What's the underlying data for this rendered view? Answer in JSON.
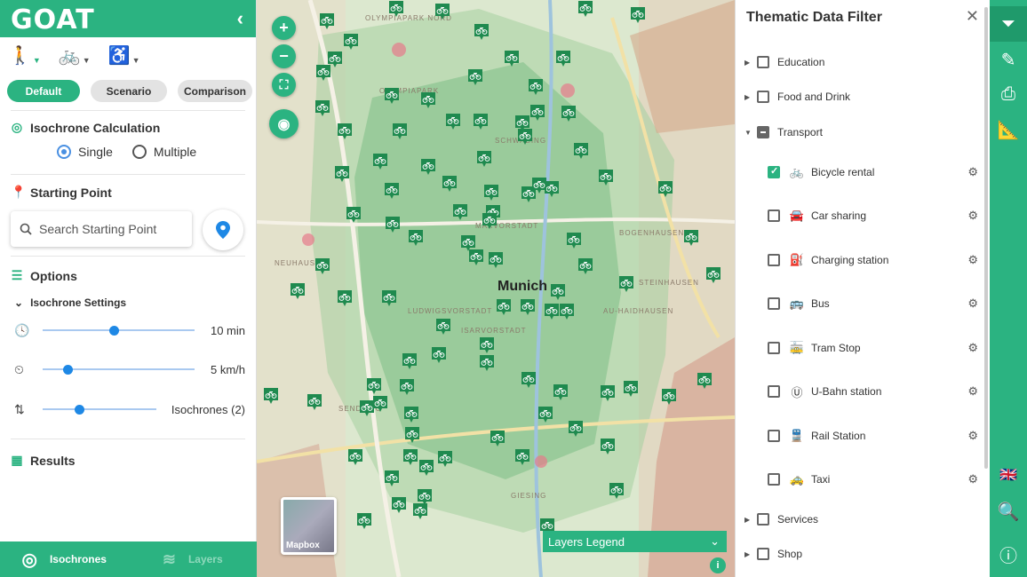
{
  "app": {
    "logo": "GOAT"
  },
  "modes": [
    {
      "name": "walking",
      "glyph": "🚶"
    },
    {
      "name": "cycling",
      "glyph": "🚲"
    },
    {
      "name": "wheelchair",
      "glyph": "♿"
    }
  ],
  "tabs": [
    "Default",
    "Scenario",
    "Comparison"
  ],
  "isochrone": {
    "title": "Isochrone Calculation",
    "single": "Single",
    "multiple": "Multiple"
  },
  "starting_point": {
    "title": "Starting Point",
    "placeholder": "Search Starting Point"
  },
  "options": {
    "title": "Options",
    "settings_title": "Isochrone Settings",
    "sliders": [
      {
        "icon": "clock-icon",
        "value": "10 min",
        "level": 0.55
      },
      {
        "icon": "speedometer-icon",
        "value": "5 km/h",
        "level": 0.17
      },
      {
        "icon": "sort-icon",
        "value": "Isochrones (2)",
        "level": 0.3
      }
    ]
  },
  "results": {
    "title": "Results"
  },
  "footer": {
    "isochrones": "Isochrones",
    "layers": "Layers"
  },
  "map": {
    "city": "Munich",
    "mapbox_label": "Mapbox",
    "legend_label": "Layers Legend",
    "labels": [
      "OLYMPIAPARK NORD",
      "OLYMPIAPARK",
      "SCHWABING",
      "MAXVORSTADT",
      "AU-HAIDHAUSEN",
      "SENDLING",
      "BOGENHAUSEN",
      "GIESING",
      "LUDWIGSVORSTADT",
      "ISARVORSTADT",
      "STEINHAUSEN",
      "NEUHAUSEN"
    ],
    "info": "i"
  },
  "filter": {
    "title": "Thematic Data Filter",
    "categories": {
      "education": "Education",
      "food": "Food and Drink",
      "transport": "Transport",
      "services": "Services",
      "shop": "Shop"
    },
    "transport_items": [
      {
        "label": "Bicycle rental",
        "icon": "🚲",
        "checked": true
      },
      {
        "label": "Car sharing",
        "icon": "🚘",
        "checked": false
      },
      {
        "label": "Charging station",
        "icon": "⛽",
        "checked": false
      },
      {
        "label": "Bus",
        "icon": "🚌",
        "checked": false
      },
      {
        "label": "Tram Stop",
        "icon": "🚋",
        "checked": false
      },
      {
        "label": "U-Bahn station",
        "icon": "Ⓤ",
        "checked": false
      },
      {
        "label": "Rail Station",
        "icon": "🚆",
        "checked": false
      },
      {
        "label": "Taxi",
        "icon": "🚕",
        "checked": false
      }
    ]
  },
  "colors": {
    "accent": "#2bb381",
    "slider": "#1e88e5"
  }
}
